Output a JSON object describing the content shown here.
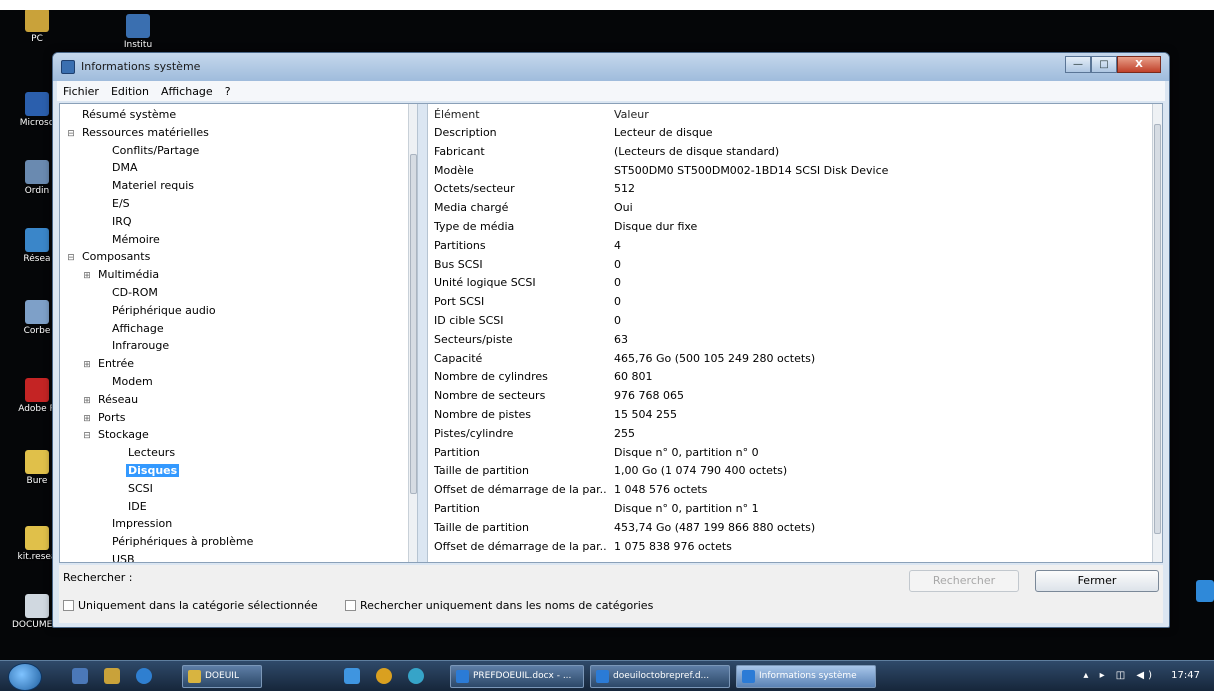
{
  "desktop": {
    "icons": [
      {
        "label": "PC",
        "color": "#c9a23a"
      },
      {
        "label": "Microso",
        "color": "#2b5fad"
      },
      {
        "label": "Ordin",
        "color": "#6a8ab0"
      },
      {
        "label": "Résea",
        "color": "#3a86c9"
      },
      {
        "label": "Corbe",
        "color": "#7ea0c8"
      },
      {
        "label": "Adobe R",
        "color": "#c42424"
      },
      {
        "label": "Bure",
        "color": "#e0c04a"
      },
      {
        "label": "kit.resea",
        "color": "#e0c04a"
      },
      {
        "label": "DOCUMENTS SCANNES",
        "color": "#d0d8e0"
      }
    ],
    "top_icon_label": "Institu"
  },
  "window": {
    "title": "Informations système",
    "controls": {
      "minimize": "—",
      "maximize": "□",
      "close": "X"
    },
    "menu": [
      "Fichier",
      "Edition",
      "Affichage",
      "?"
    ]
  },
  "tree": [
    {
      "label": "Résumé système",
      "level": 0,
      "exp": ""
    },
    {
      "label": "Ressources matérielles",
      "level": 0,
      "exp": "⊟"
    },
    {
      "label": "Conflits/Partage",
      "level": 2,
      "exp": ""
    },
    {
      "label": "DMA",
      "level": 2,
      "exp": ""
    },
    {
      "label": "Materiel requis",
      "level": 2,
      "exp": ""
    },
    {
      "label": "E/S",
      "level": 2,
      "exp": ""
    },
    {
      "label": "IRQ",
      "level": 2,
      "exp": ""
    },
    {
      "label": "Mémoire",
      "level": 2,
      "exp": ""
    },
    {
      "label": "Composants",
      "level": 0,
      "exp": "⊟"
    },
    {
      "label": "Multimédia",
      "level": 1,
      "exp": "⊞"
    },
    {
      "label": "CD-ROM",
      "level": 2,
      "exp": ""
    },
    {
      "label": "Périphérique audio",
      "level": 2,
      "exp": ""
    },
    {
      "label": "Affichage",
      "level": 2,
      "exp": ""
    },
    {
      "label": "Infrarouge",
      "level": 2,
      "exp": ""
    },
    {
      "label": "Entrée",
      "level": 1,
      "exp": "⊞"
    },
    {
      "label": "Modem",
      "level": 2,
      "exp": ""
    },
    {
      "label": "Réseau",
      "level": 1,
      "exp": "⊞"
    },
    {
      "label": "Ports",
      "level": 1,
      "exp": "⊞"
    },
    {
      "label": "Stockage",
      "level": 1,
      "exp": "⊟"
    },
    {
      "label": "Lecteurs",
      "level": 3,
      "exp": ""
    },
    {
      "label": "Disques",
      "level": 3,
      "exp": "",
      "selected": true
    },
    {
      "label": "SCSI",
      "level": 3,
      "exp": ""
    },
    {
      "label": "IDE",
      "level": 3,
      "exp": ""
    },
    {
      "label": "Impression",
      "level": 2,
      "exp": ""
    },
    {
      "label": "Périphériques à problème",
      "level": 2,
      "exp": ""
    },
    {
      "label": "USB",
      "level": 2,
      "exp": ""
    }
  ],
  "detail": {
    "headers": [
      "Élément",
      "Valeur"
    ],
    "rows": [
      [
        "Description",
        "Lecteur de disque"
      ],
      [
        "Fabricant",
        "(Lecteurs de disque standard)"
      ],
      [
        "Modèle",
        "ST500DM0 ST500DM002-1BD14 SCSI Disk Device"
      ],
      [
        "Octets/secteur",
        "512"
      ],
      [
        "Media chargé",
        "Oui"
      ],
      [
        "Type de média",
        "Disque dur fixe"
      ],
      [
        "Partitions",
        "4"
      ],
      [
        "Bus SCSI",
        "0"
      ],
      [
        "Unité logique SCSI",
        "0"
      ],
      [
        "Port SCSI",
        "0"
      ],
      [
        "ID cible SCSI",
        "0"
      ],
      [
        "Secteurs/piste",
        "63"
      ],
      [
        "Capacité",
        "465,76 Go (500 105 249 280 octets)"
      ],
      [
        "Nombre de cylindres",
        "60 801"
      ],
      [
        "Nombre de secteurs",
        "976 768 065"
      ],
      [
        "Nombre de pistes",
        "15 504 255"
      ],
      [
        "Pistes/cylindre",
        "255"
      ],
      [
        "Partition",
        "Disque n° 0, partition n° 0"
      ],
      [
        "Taille de partition",
        "1,00 Go (1 074 790 400 octets)"
      ],
      [
        "Offset de démarrage de la par...",
        "1 048 576 octets"
      ],
      [
        "Partition",
        "Disque n° 0, partition n° 1"
      ],
      [
        "Taille de partition",
        "453,74 Go (487 199 866 880 octets)"
      ],
      [
        "Offset de démarrage de la par...",
        "1 075 838 976 octets"
      ]
    ]
  },
  "search": {
    "label": "Rechercher :",
    "search_button": "Rechercher",
    "close_button": "Fermer",
    "opt_category": "Uniquement dans la catégorie sélectionnée",
    "opt_names": "Rechercher uniquement dans les noms de catégories"
  },
  "taskbar": {
    "buttons": [
      {
        "label": "DOEUIL",
        "active": false
      },
      {
        "label": "PREFDOEUIL.docx - ...",
        "active": false
      },
      {
        "label": "doeuiloctobrepref.d...",
        "active": false
      },
      {
        "label": "Informations système",
        "active": true
      }
    ],
    "tray": "▴ ▸ ◫ ◀)",
    "clock": "17:47"
  }
}
